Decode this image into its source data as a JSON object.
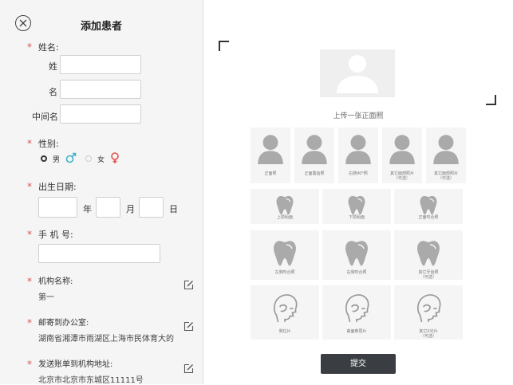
{
  "header": {
    "title": "添加患者"
  },
  "form": {
    "required_mark": "*",
    "name_label": "姓名:",
    "surname_label": "姓",
    "given_label": "名",
    "middle_label": "中间名",
    "gender_label": "性别:",
    "gender_male": "男",
    "gender_female": "女",
    "dob_label": "出生日期:",
    "year_label": "年",
    "month_label": "月",
    "day_label": "日",
    "phone_label": "手 机 号:",
    "org_label": "机构名称:",
    "org_value": "第一",
    "mail_label": "邮寄到办公室:",
    "mail_value": "湖南省湘潭市雨湖区上海市民体育大的",
    "billing_label": "发送账单到机构地址:",
    "billing_value": "北京市北京市东城区11111号"
  },
  "upload": {
    "prompt": "上传一张正面照",
    "face_photos": [
      "正面照",
      "正面露齿照",
      "右侧90°照",
      "其它面部照片",
      "其它面部照片"
    ],
    "face_optional": [
      "",
      "",
      "",
      "（可选）",
      "（可选）"
    ],
    "teeth_row1": [
      "上颌殆面",
      "下颌殆面",
      "正面咬合照"
    ],
    "teeth_row2": [
      "左侧咬合照",
      "右侧咬合照",
      "其它牙齿照"
    ],
    "teeth_row2_optional": [
      "",
      "",
      "（可选）"
    ],
    "xray": [
      "侧位片",
      "曲面断层片",
      "其它X光片"
    ],
    "xray_optional": [
      "",
      "",
      "（可选）"
    ],
    "submit": "提交"
  },
  "colors": {
    "required": "#e0524f",
    "male": "#3cb4c6",
    "female": "#e0524f",
    "submit_bg": "#3a3e43"
  }
}
